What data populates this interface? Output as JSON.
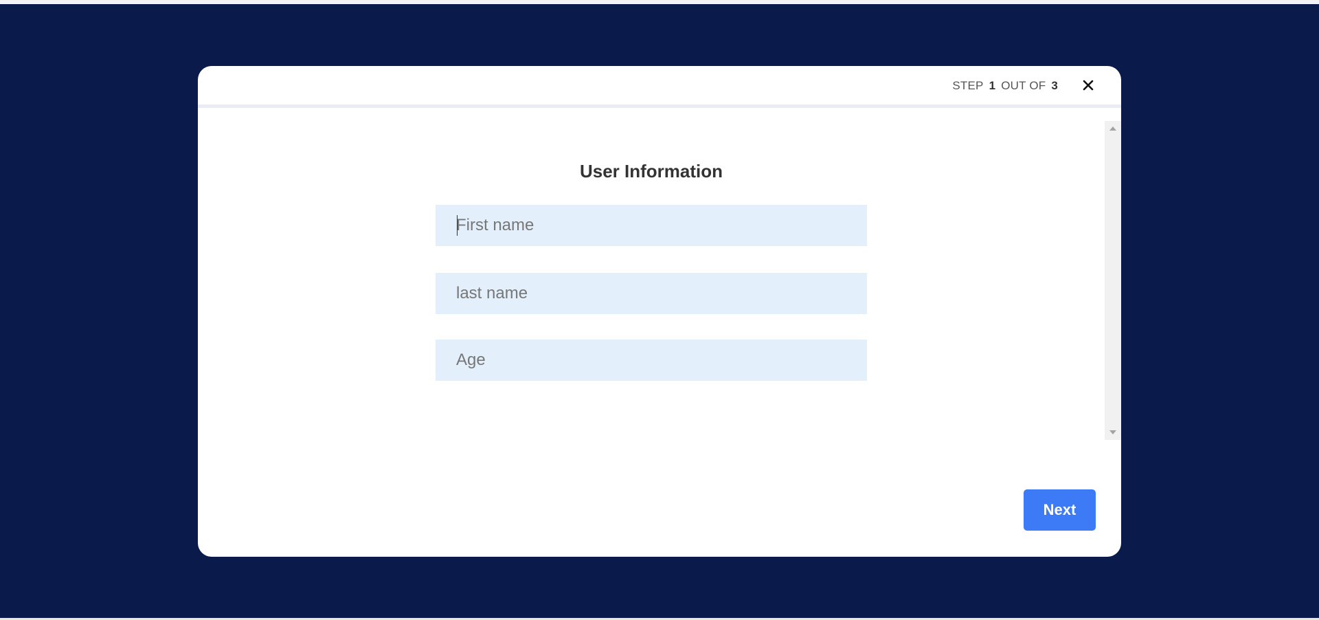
{
  "modal": {
    "step": {
      "prefix": "STEP",
      "current": "1",
      "separator": "OUT OF",
      "total": "3"
    },
    "title": "User Information",
    "fields": {
      "first_name": {
        "value": "",
        "placeholder": "First name"
      },
      "last_name": {
        "value": "",
        "placeholder": "last name"
      },
      "age": {
        "value": "",
        "placeholder": "Age"
      }
    },
    "next_label": "Next"
  },
  "colors": {
    "backdrop": "#0a1a4a",
    "field_bg": "#e3f0fb",
    "primary_button": "#3c7bf5"
  },
  "icons": {
    "close": "close-icon"
  }
}
